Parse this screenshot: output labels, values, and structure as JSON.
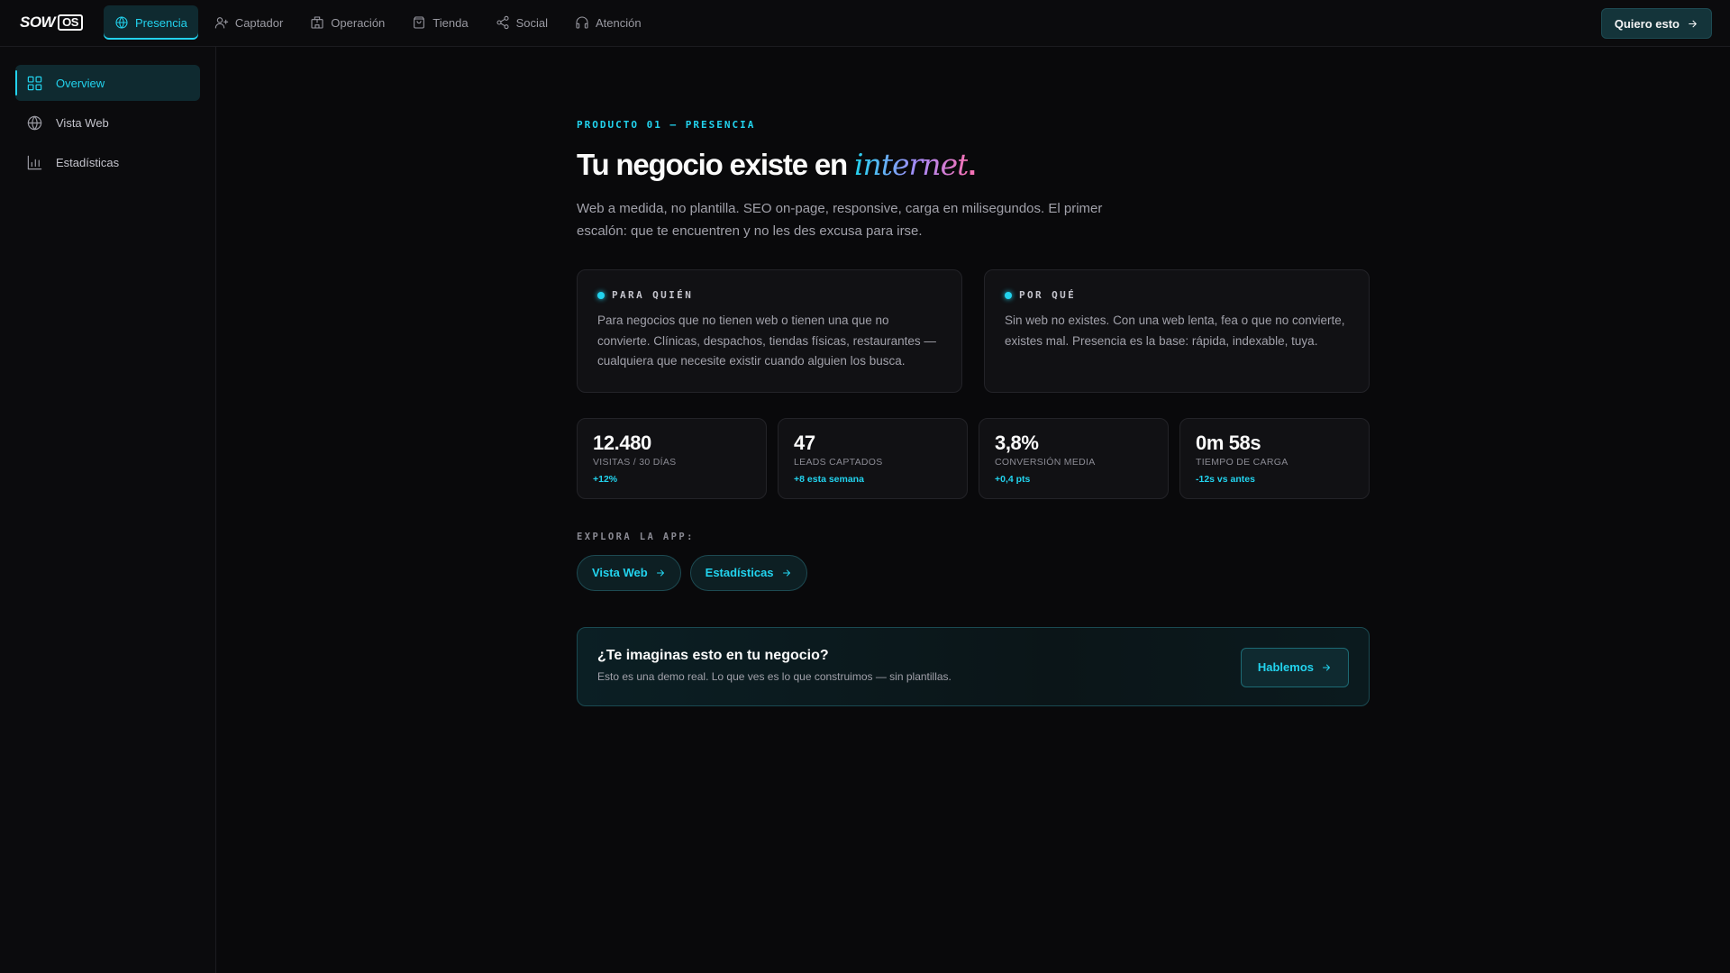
{
  "app": {
    "logo_word": "SOW",
    "logo_box": "OS"
  },
  "nav": {
    "items": [
      {
        "label": "Presencia",
        "icon": "globe-icon",
        "active": true
      },
      {
        "label": "Captador",
        "icon": "user-plus-icon"
      },
      {
        "label": "Operación",
        "icon": "building-icon"
      },
      {
        "label": "Tienda",
        "icon": "shopping-bag-icon"
      },
      {
        "label": "Social",
        "icon": "share-icon"
      },
      {
        "label": "Atención",
        "icon": "headphones-icon"
      }
    ],
    "cta_label": "Quiero esto"
  },
  "sidebar": {
    "items": [
      {
        "label": "Overview",
        "icon": "grid-icon",
        "active": true
      },
      {
        "label": "Vista Web",
        "icon": "globe-icon"
      },
      {
        "label": "Estadísticas",
        "icon": "bar-chart-icon"
      }
    ]
  },
  "hero": {
    "eyebrow": "PRODUCTO 01 — PRESENCIA",
    "title_prefix": "Tu negocio existe en ",
    "title_accent": "internet",
    "title_suffix": ".",
    "lead": "Web a medida, no plantilla. SEO on-page, responsive, carga en milisegundos. El primer escalón: que te encuentren y no les des excusa para irse."
  },
  "info_cards": [
    {
      "heading": "PARA QUIÉN",
      "text": "Para negocios que no tienen web o tienen una que no convierte. Clínicas, despachos, tiendas físicas, restaurantes — cualquiera que necesite existir cuando alguien los busca."
    },
    {
      "heading": "POR QUÉ",
      "text": "Sin web no existes. Con una web lenta, fea o que no convierte, existes mal. Presencia es la base: rápida, indexable, tuya."
    }
  ],
  "stats": [
    {
      "value": "12.480",
      "label": "VISITAS / 30 DÍAS",
      "delta": "+12%"
    },
    {
      "value": "47",
      "label": "LEADS CAPTADOS",
      "delta": "+8 esta semana"
    },
    {
      "value": "3,8%",
      "label": "CONVERSIÓN MEDIA",
      "delta": "+0,4 pts"
    },
    {
      "value": "0m 58s",
      "label": "TIEMPO DE CARGA",
      "delta": "-12s vs antes"
    }
  ],
  "explore": {
    "label": "EXPLORA LA APP:",
    "links": [
      "Vista Web",
      "Estadísticas"
    ]
  },
  "banner": {
    "title": "¿Te imaginas esto en tu negocio?",
    "subtitle": "Esto es una demo real. Lo que ves es lo que construimos — sin plantillas.",
    "button_label": "Hablemos"
  },
  "colors": {
    "accent": "#22d3ee",
    "background": "#09090b",
    "card": "#111114",
    "gradient_end": "#f472b6"
  }
}
